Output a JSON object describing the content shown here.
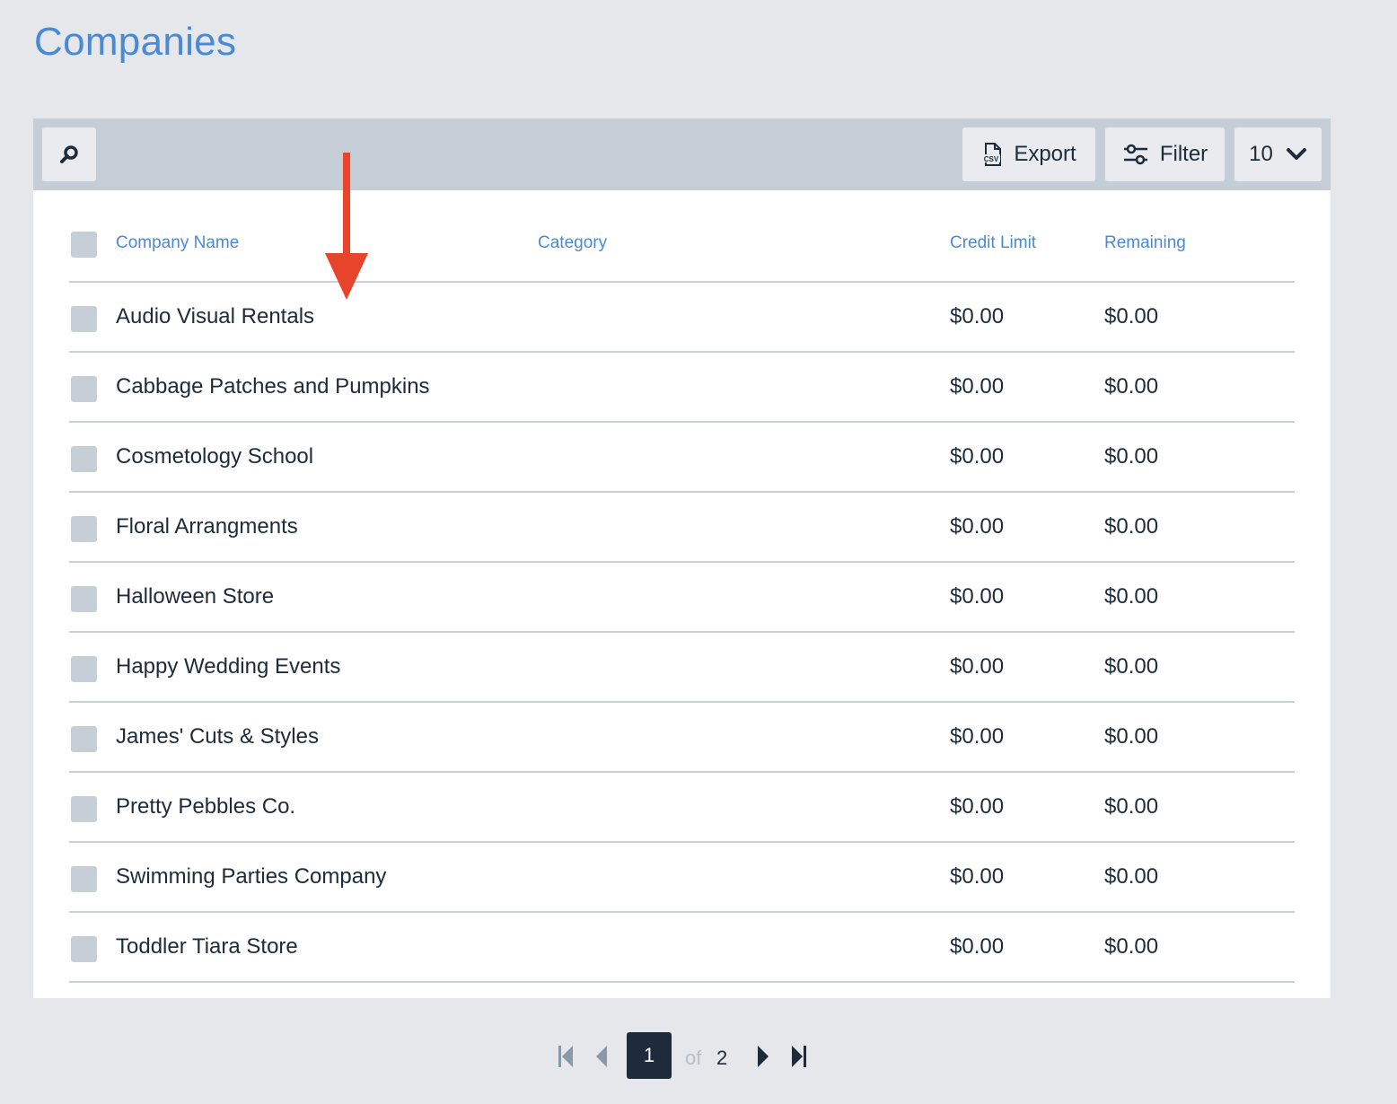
{
  "page": {
    "title": "Companies"
  },
  "toolbar": {
    "export_label": "Export",
    "export_icon_text": "CSV",
    "filter_label": "Filter",
    "page_size": "10"
  },
  "table": {
    "headers": {
      "name": "Company Name",
      "category": "Category",
      "credit_limit": "Credit Limit",
      "remaining": "Remaining"
    },
    "rows": [
      {
        "name": "Audio Visual Rentals",
        "category": "",
        "credit_limit": "$0.00",
        "remaining": "$0.00"
      },
      {
        "name": "Cabbage Patches and Pumpkins",
        "category": "",
        "credit_limit": "$0.00",
        "remaining": "$0.00"
      },
      {
        "name": "Cosmetology School",
        "category": "",
        "credit_limit": "$0.00",
        "remaining": "$0.00"
      },
      {
        "name": "Floral Arrangments",
        "category": "",
        "credit_limit": "$0.00",
        "remaining": "$0.00"
      },
      {
        "name": "Halloween Store",
        "category": "",
        "credit_limit": "$0.00",
        "remaining": "$0.00"
      },
      {
        "name": "Happy Wedding Events",
        "category": "",
        "credit_limit": "$0.00",
        "remaining": "$0.00"
      },
      {
        "name": "James' Cuts & Styles",
        "category": "",
        "credit_limit": "$0.00",
        "remaining": "$0.00"
      },
      {
        "name": "Pretty Pebbles Co.",
        "category": "",
        "credit_limit": "$0.00",
        "remaining": "$0.00"
      },
      {
        "name": "Swimming Parties Company",
        "category": "",
        "credit_limit": "$0.00",
        "remaining": "$0.00"
      },
      {
        "name": "Toddler Tiara Store",
        "category": "",
        "credit_limit": "$0.00",
        "remaining": "$0.00"
      }
    ]
  },
  "pagination": {
    "current": "1",
    "of_label": "of",
    "total": "2"
  },
  "colors": {
    "accent": "#4a8ad4",
    "toolbar_bg": "#c5ced6",
    "page_bg": "#e5e7ea",
    "text": "#1d2b3a",
    "annotation_arrow": "#e8432b"
  },
  "icons": {
    "search": "magnifier-icon",
    "export": "csv-file-icon",
    "filter": "sliders-icon",
    "page_size": "chevron-down-icon",
    "first": "first-page-icon",
    "prev": "prev-page-icon",
    "next": "next-page-icon",
    "last": "last-page-icon"
  }
}
